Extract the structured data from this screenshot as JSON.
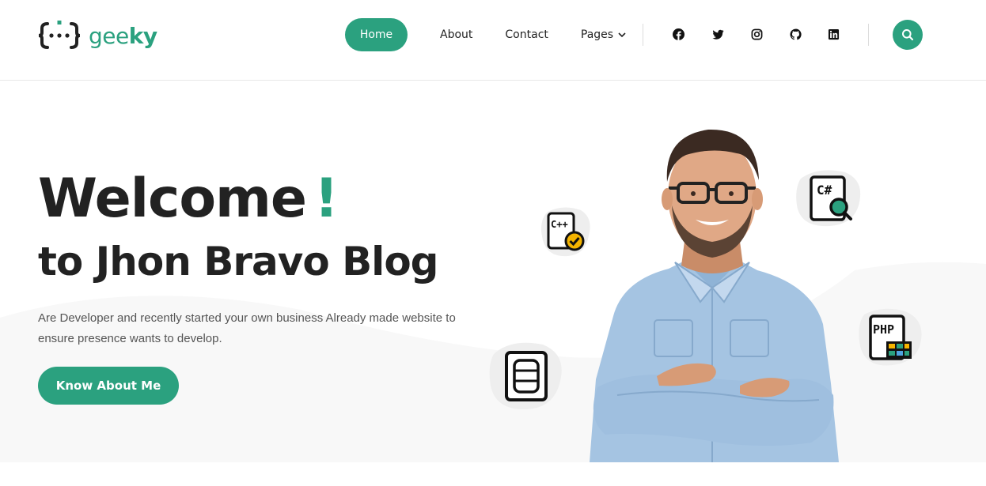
{
  "brand": {
    "name_light": "gee",
    "name_bold": "ky",
    "color": "#2ba17f"
  },
  "nav": {
    "items": [
      {
        "label": "Home",
        "active": true
      },
      {
        "label": "About"
      },
      {
        "label": "Contact"
      },
      {
        "label": "Pages",
        "dropdown": true
      }
    ]
  },
  "social": [
    "facebook-icon",
    "twitter-icon",
    "instagram-icon",
    "github-icon",
    "linkedin-icon"
  ],
  "hero": {
    "title": "Welcome",
    "title_accent": "!",
    "subtitle": "to Jhon Bravo Blog",
    "description": "Are Developer and recently started your own business Already made website to ensure presence wants to develop.",
    "cta_label": "Know About Me"
  },
  "floating_icons": [
    {
      "name": "cpp-check-icon",
      "text": "C++"
    },
    {
      "name": "csharp-search-icon",
      "text": "C#"
    },
    {
      "name": "php-icon",
      "text": "PHP"
    },
    {
      "name": "database-icon"
    }
  ],
  "colors": {
    "accent": "#2ba17f",
    "text": "#222222",
    "muted": "#555555"
  }
}
